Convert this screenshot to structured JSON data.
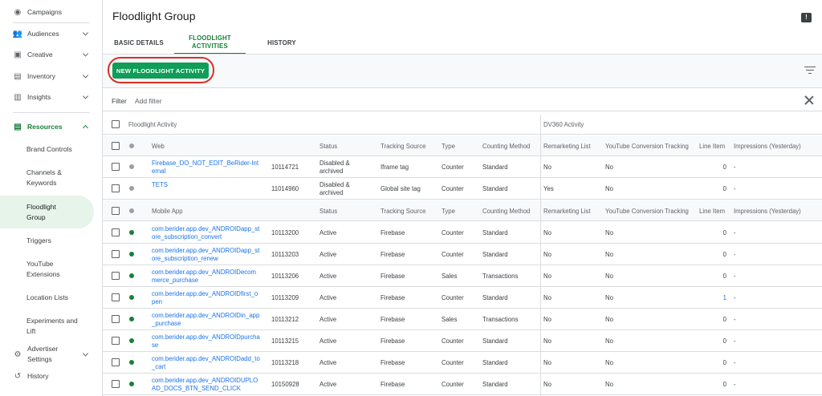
{
  "sidebar": {
    "items": [
      {
        "label": "Campaigns",
        "icon": "campaigns-icon",
        "glyph": "◉"
      },
      {
        "label": "Audiences",
        "icon": "audiences-icon",
        "glyph": "👥"
      },
      {
        "label": "Creative",
        "icon": "creative-icon",
        "glyph": "▣"
      },
      {
        "label": "Inventory",
        "icon": "inventory-icon",
        "glyph": "▤"
      },
      {
        "label": "Insights",
        "icon": "insights-icon",
        "glyph": "▥"
      },
      {
        "label": "Resources",
        "icon": "resources-icon",
        "glyph": "▤"
      }
    ],
    "sub_items": [
      "Brand Controls",
      "Channels & Keywords",
      "Floodlight Group",
      "Triggers",
      "YouTube Extensions",
      "Location Lists",
      "Experiments and Lift"
    ],
    "bottom": [
      {
        "label": "Advertiser Settings",
        "icon": "gear-icon",
        "glyph": "⚙"
      },
      {
        "label": "History",
        "icon": "history-icon",
        "glyph": "↺"
      }
    ]
  },
  "header": {
    "title": "Floodlight Group",
    "feedback_glyph": "!",
    "tabs": [
      "BASIC DETAILS",
      "FLOODLIGHT ACTIVITIES",
      "HISTORY"
    ]
  },
  "toolbar": {
    "new_button_label": "NEW FLOODLIGHT ACTIVITY",
    "filter_label": "Filter",
    "filter_placeholder": "Add filter"
  },
  "table": {
    "group_headers": {
      "floodlight": "Floodlight Activity",
      "dv360": "DV360 Activity"
    },
    "columns": [
      "Status",
      "Tracking Source",
      "Type",
      "Counting Method",
      "Remarketing List",
      "YouTube Conversion Tracking",
      "Line Item",
      "Impressions (Yesterday)"
    ],
    "sections": [
      {
        "name": "Web",
        "rows": [
          {
            "name": "Firebase_DO_NOT_EDIT_BeRider-Internal",
            "id": "10114721",
            "status": "Disabled & archived",
            "source": "Iframe tag",
            "type": "Counter",
            "method": "Standard",
            "remarketing": "No",
            "youtube": "No",
            "line_item": "0",
            "impressions": "-",
            "active": false
          },
          {
            "name": "TETS",
            "id": "11014960",
            "status": "Disabled & archived",
            "source": "Global site tag",
            "type": "Counter",
            "method": "Standard",
            "remarketing": "Yes",
            "youtube": "No",
            "line_item": "0",
            "impressions": "-",
            "active": false
          }
        ]
      },
      {
        "name": "Mobile App",
        "rows": [
          {
            "name": "com.berider.app.dev_ANDROIDapp_store_subscription_convert",
            "id": "10113200",
            "status": "Active",
            "source": "Firebase",
            "type": "Counter",
            "method": "Standard",
            "remarketing": "No",
            "youtube": "No",
            "line_item": "0",
            "impressions": "-",
            "active": true
          },
          {
            "name": "com.berider.app.dev_ANDROIDapp_store_subscription_renew",
            "id": "10113203",
            "status": "Active",
            "source": "Firebase",
            "type": "Counter",
            "method": "Standard",
            "remarketing": "No",
            "youtube": "No",
            "line_item": "0",
            "impressions": "-",
            "active": true
          },
          {
            "name": "com.berider.app.dev_ANDROIDecommerce_purchase",
            "id": "10113206",
            "status": "Active",
            "source": "Firebase",
            "type": "Sales",
            "method": "Transactions",
            "remarketing": "No",
            "youtube": "No",
            "line_item": "0",
            "impressions": "-",
            "active": true
          },
          {
            "name": "com.berider.app.dev_ANDROIDfirst_open",
            "id": "10113209",
            "status": "Active",
            "source": "Firebase",
            "type": "Counter",
            "method": "Standard",
            "remarketing": "No",
            "youtube": "No",
            "line_item": "1",
            "impressions": "-",
            "active": true
          },
          {
            "name": "com.berider.app.dev_ANDROIDin_app_purchase",
            "id": "10113212",
            "status": "Active",
            "source": "Firebase",
            "type": "Sales",
            "method": "Transactions",
            "remarketing": "No",
            "youtube": "No",
            "line_item": "0",
            "impressions": "-",
            "active": true
          },
          {
            "name": "com.berider.app.dev_ANDROIDpurchase",
            "id": "10113215",
            "status": "Active",
            "source": "Firebase",
            "type": "Counter",
            "method": "Standard",
            "remarketing": "No",
            "youtube": "No",
            "line_item": "0",
            "impressions": "-",
            "active": true
          },
          {
            "name": "com.berider.app.dev_ANDROIDadd_to_cart",
            "id": "10113218",
            "status": "Active",
            "source": "Firebase",
            "type": "Counter",
            "method": "Standard",
            "remarketing": "No",
            "youtube": "No",
            "line_item": "0",
            "impressions": "-",
            "active": true
          },
          {
            "name": "com.berider.app.dev_ANDROIDUPLOAD_DOCS_BTN_SEND_CLICK",
            "id": "10150928",
            "status": "Active",
            "source": "Firebase",
            "type": "Counter",
            "method": "Standard",
            "remarketing": "No",
            "youtube": "No",
            "line_item": "0",
            "impressions": "-",
            "active": true
          }
        ]
      }
    ]
  },
  "colors": {
    "accent": "#188038",
    "button": "#0f9d58",
    "link": "#1a73e8",
    "highlight": "#d93025"
  }
}
